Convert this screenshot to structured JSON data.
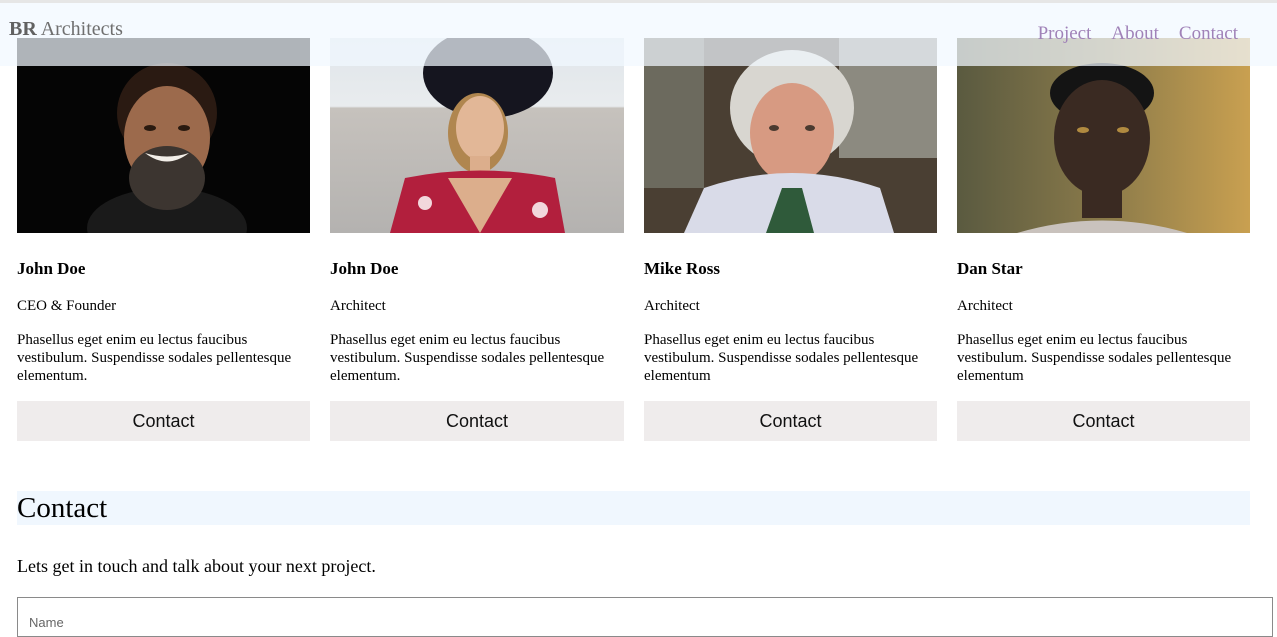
{
  "header": {
    "brand_bold": "BR",
    "brand_rest": " Architects",
    "nav": [
      {
        "label": "Project"
      },
      {
        "label": "About"
      },
      {
        "label": "Contact"
      }
    ]
  },
  "team": [
    {
      "name": "John Doe",
      "role": "CEO & Founder",
      "description": "Phasellus eget enim eu lectus faucibus vestibulum. Suspendisse sodales pellentesque elementum.",
      "button": "Contact"
    },
    {
      "name": "John Doe",
      "role": "Architect",
      "description": "Phasellus eget enim eu lectus faucibus vestibulum. Suspendisse sodales pellentesque elementum.",
      "button": "Contact"
    },
    {
      "name": "Mike Ross",
      "role": "Architect",
      "description": "Phasellus eget enim eu lectus faucibus vestibulum. Suspendisse sodales pellentesque elementum",
      "button": "Contact"
    },
    {
      "name": "Dan Star",
      "role": "Architect",
      "description": "Phasellus eget enim eu lectus faucibus vestibulum. Suspendisse sodales pellentesque elementum",
      "button": "Contact"
    }
  ],
  "contact": {
    "heading": "Contact",
    "text": "Lets get in touch and talk about your next project.",
    "name_placeholder": "Name"
  },
  "colors": {
    "nav_link": "#a082b8",
    "navbar_bg": "#f1f8ff",
    "button_bg": "#efecec",
    "heading_bg": "#f0f7fe"
  }
}
